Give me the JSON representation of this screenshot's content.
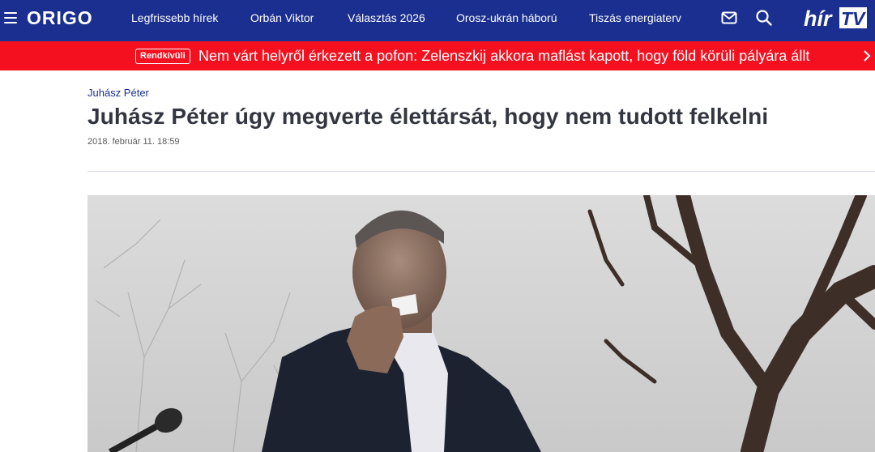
{
  "header": {
    "logo": "ORIGO",
    "nav": [
      {
        "label": "Legfrissebb hírek"
      },
      {
        "label": "Orbán Viktor"
      },
      {
        "label": "Választás 2026"
      },
      {
        "label": "Orosz-ukrán háború"
      },
      {
        "label": "Tiszás energiaterv"
      }
    ],
    "hirtv_logo": "hírTV",
    "icons": [
      "menu-icon",
      "mail-icon",
      "search-icon"
    ],
    "bg_color": "#1a2f8f"
  },
  "breaking": {
    "badge": "Rendkívüli",
    "text": "Nem várt helyről érkezett a pofon: Zelenszkij akkora maflást kapott, hogy föld körüli pályára állt",
    "bg_color": "#f4101e"
  },
  "article": {
    "category": "Juhász Péter",
    "title": "Juhász Péter úgy megverte élettársát, hogy nem tudott felkelni",
    "date": "2018. február 11. 18:59"
  }
}
